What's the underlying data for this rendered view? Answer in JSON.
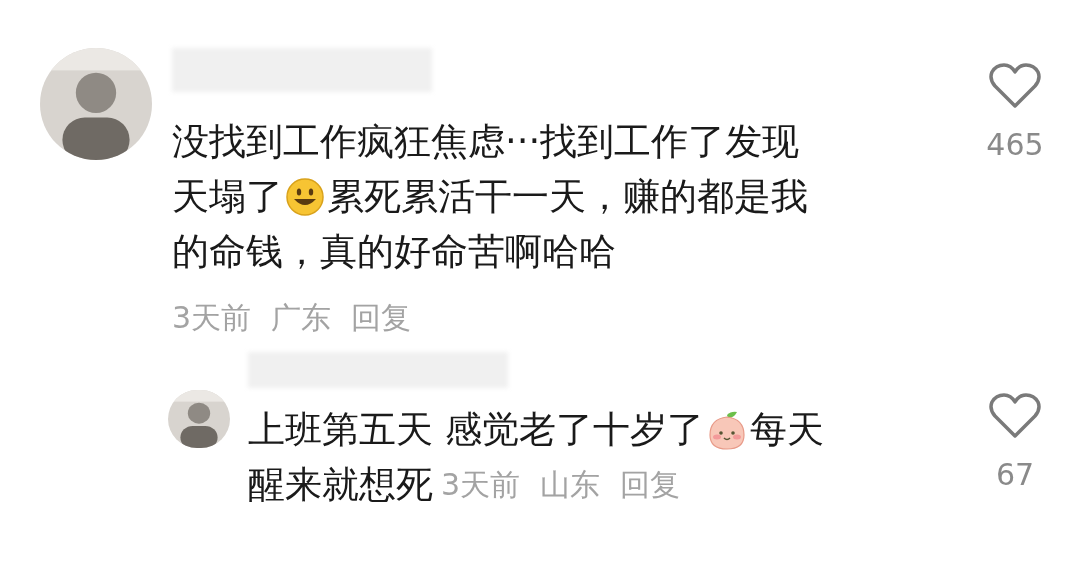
{
  "comments": [
    {
      "kind": "comment",
      "lines": [
        [
          {
            "kind": "text",
            "text": "没找到工作疯狂焦虑···找到工作了发现"
          }
        ],
        [
          {
            "kind": "text",
            "text": "天塌了"
          },
          {
            "kind": "smiley"
          },
          {
            "kind": "text",
            "text": "累死累活干一天，赚的都是我"
          }
        ],
        [
          {
            "kind": "text",
            "text": "的命钱，真的好命苦啊哈哈"
          }
        ]
      ],
      "time": "3天前",
      "location": "广东",
      "reply": "回复",
      "likes": "465"
    },
    {
      "kind": "reply",
      "lines": [
        [
          {
            "kind": "text",
            "text": "上班第五天 感觉老了十岁了"
          },
          {
            "kind": "peach"
          },
          {
            "kind": "text",
            "text": "每天"
          }
        ],
        [
          {
            "kind": "text",
            "text": "醒来就想死"
          }
        ]
      ],
      "time": "3天前",
      "location": "山东",
      "reply": "回复",
      "likes": "67"
    }
  ]
}
